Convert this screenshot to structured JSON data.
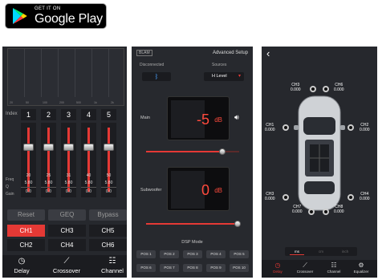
{
  "badge": {
    "small": "GET IT ON",
    "big": "Google Play"
  },
  "eq": {
    "hz_ticks": [
      "20",
      "50",
      "100",
      "200",
      "500",
      "1k",
      "2k"
    ],
    "index_label": "Index",
    "indexes": [
      "1",
      "2",
      "3",
      "4",
      "5"
    ],
    "row_labels": [
      "Freq",
      "Q",
      "Gain"
    ],
    "freq": [
      "20",
      "25",
      "31",
      "40",
      "50"
    ],
    "q": [
      "5.80",
      "5.80",
      "5.80",
      "5.80",
      "5.80"
    ],
    "gain": [
      "0.0",
      "0.0",
      "0.0",
      "0.0",
      "0.0"
    ],
    "buttons": [
      "Reset",
      "GEQ",
      "Bypass"
    ],
    "channels": [
      "CH1",
      "CH3",
      "CH5",
      "CH2",
      "CH4",
      "CH6"
    ],
    "active_channel": "CH1",
    "nav": [
      {
        "label": "Delay",
        "icon": "clock-icon"
      },
      {
        "label": "Crossover",
        "icon": "crossover-icon"
      },
      {
        "label": "Channel",
        "icon": "sliders-icon"
      }
    ]
  },
  "adv": {
    "logo": "BLAM",
    "title": "Advanced Setup",
    "conn_label": "Disconnected",
    "sources_label": "Sources",
    "source_value": "H Level",
    "main_label": "Main",
    "main_value": "-5",
    "main_unit": "dB",
    "sub_label": "Subwoofer",
    "sub_value": "0",
    "sub_unit": "dB",
    "main_level": 0.82,
    "sub_level": 0.98,
    "dsp_label": "DSP Mode",
    "positions": [
      "POS 1",
      "POS 2",
      "POS 3",
      "POS 4",
      "POS 5",
      "POS 6",
      "POS 7",
      "POS 8",
      "POS 9",
      "POS 10"
    ],
    "accent": "#e53935"
  },
  "channel": {
    "channels": [
      {
        "name": "CH1",
        "value": "0.000"
      },
      {
        "name": "CH2",
        "value": "0.000"
      },
      {
        "name": "CH3",
        "value": "0.000"
      },
      {
        "name": "CH4",
        "value": "0.000"
      },
      {
        "name": "CH5",
        "value": "0.000"
      },
      {
        "name": "CH6",
        "value": "0.000"
      },
      {
        "name": "CH7",
        "value": "0.000"
      },
      {
        "name": "CH8",
        "value": "0.000"
      },
      {
        "name": "CH3",
        "value": "0.000"
      }
    ],
    "units": [
      "ms",
      "cm",
      "inch"
    ],
    "nav": [
      {
        "label": "Delay",
        "icon": "clock-icon"
      },
      {
        "label": "Crossover",
        "icon": "crossover-icon"
      },
      {
        "label": "Channel",
        "icon": "sliders-icon"
      },
      {
        "label": "Equalizer",
        "icon": "gear-icon"
      }
    ]
  }
}
